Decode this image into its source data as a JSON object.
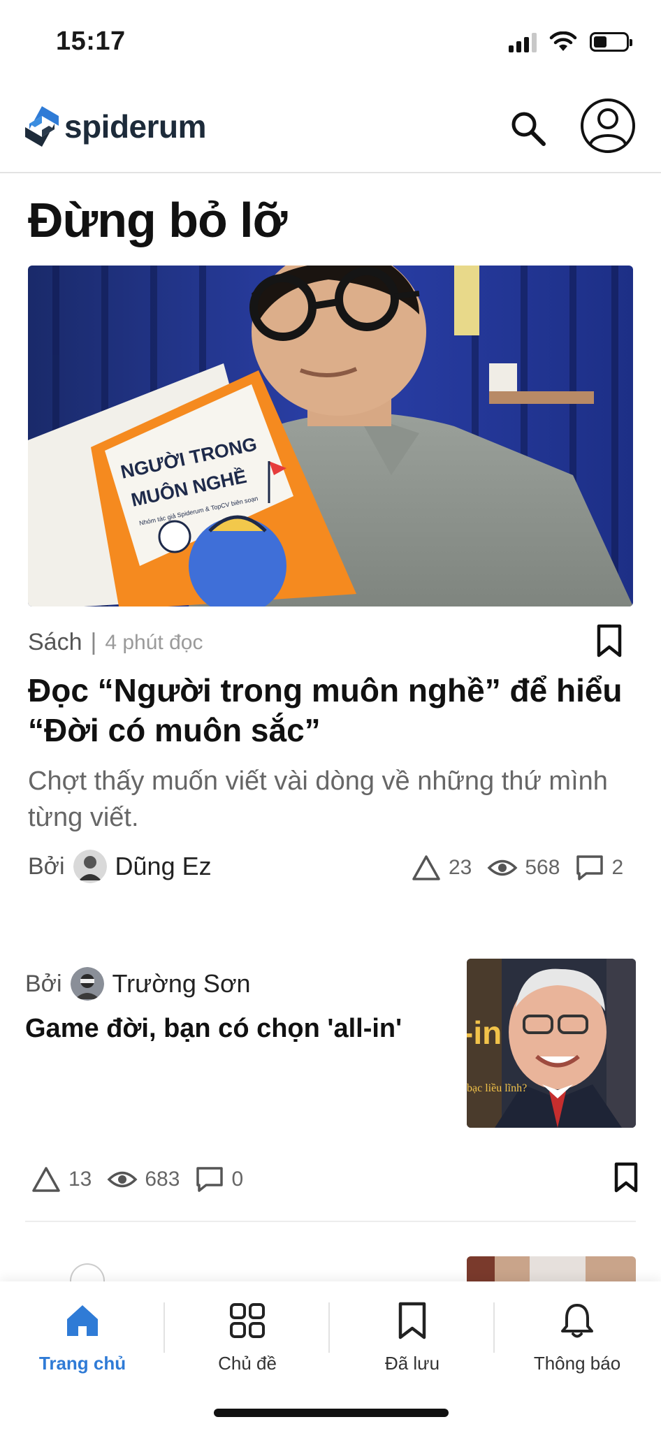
{
  "status_bar": {
    "time": "15:17"
  },
  "header": {
    "brand": "spiderum",
    "icons": [
      "search-icon",
      "account-icon"
    ],
    "brand_color": "#1d2b3a",
    "accent_color": "#2f7bd6"
  },
  "section": {
    "title": "Đừng bỏ lỡ"
  },
  "featured": {
    "category": "Sách",
    "separator": "|",
    "read_time": "4 phút đọc",
    "title": "Đọc “Người trong muôn nghề” để hiểu “Đời có muôn sắc”",
    "description": "Chợt thấy muốn viết vài dòng về những thứ mình từng viết.",
    "by_label": "Bởi",
    "author": "Dũng Ez",
    "upvotes": "23",
    "views": "568",
    "comments": "2",
    "image_book_title_line1": "NGƯỜI TRONG",
    "image_book_title_line2": "MUÔN NGHỀ",
    "image_book_subtitle": "Nhóm tác giả Spiderum & TopCV biên soạn"
  },
  "article2": {
    "by_label": "Bởi",
    "author": "Trường Sơn",
    "title": "Game đời, bạn có chọn 'all-in'",
    "upvotes": "13",
    "views": "683",
    "comments": "0",
    "thumb_text_big": "-in",
    "thumb_text_small": "bạc liều lĩnh?"
  },
  "bottom_nav": {
    "items": [
      {
        "label": "Trang chủ",
        "icon": "home-icon",
        "active": true
      },
      {
        "label": "Chủ đề",
        "icon": "grid-icon",
        "active": false
      },
      {
        "label": "Đã lưu",
        "icon": "bookmark-icon",
        "active": false
      },
      {
        "label": "Thông báo",
        "icon": "bell-icon",
        "active": false
      }
    ]
  }
}
